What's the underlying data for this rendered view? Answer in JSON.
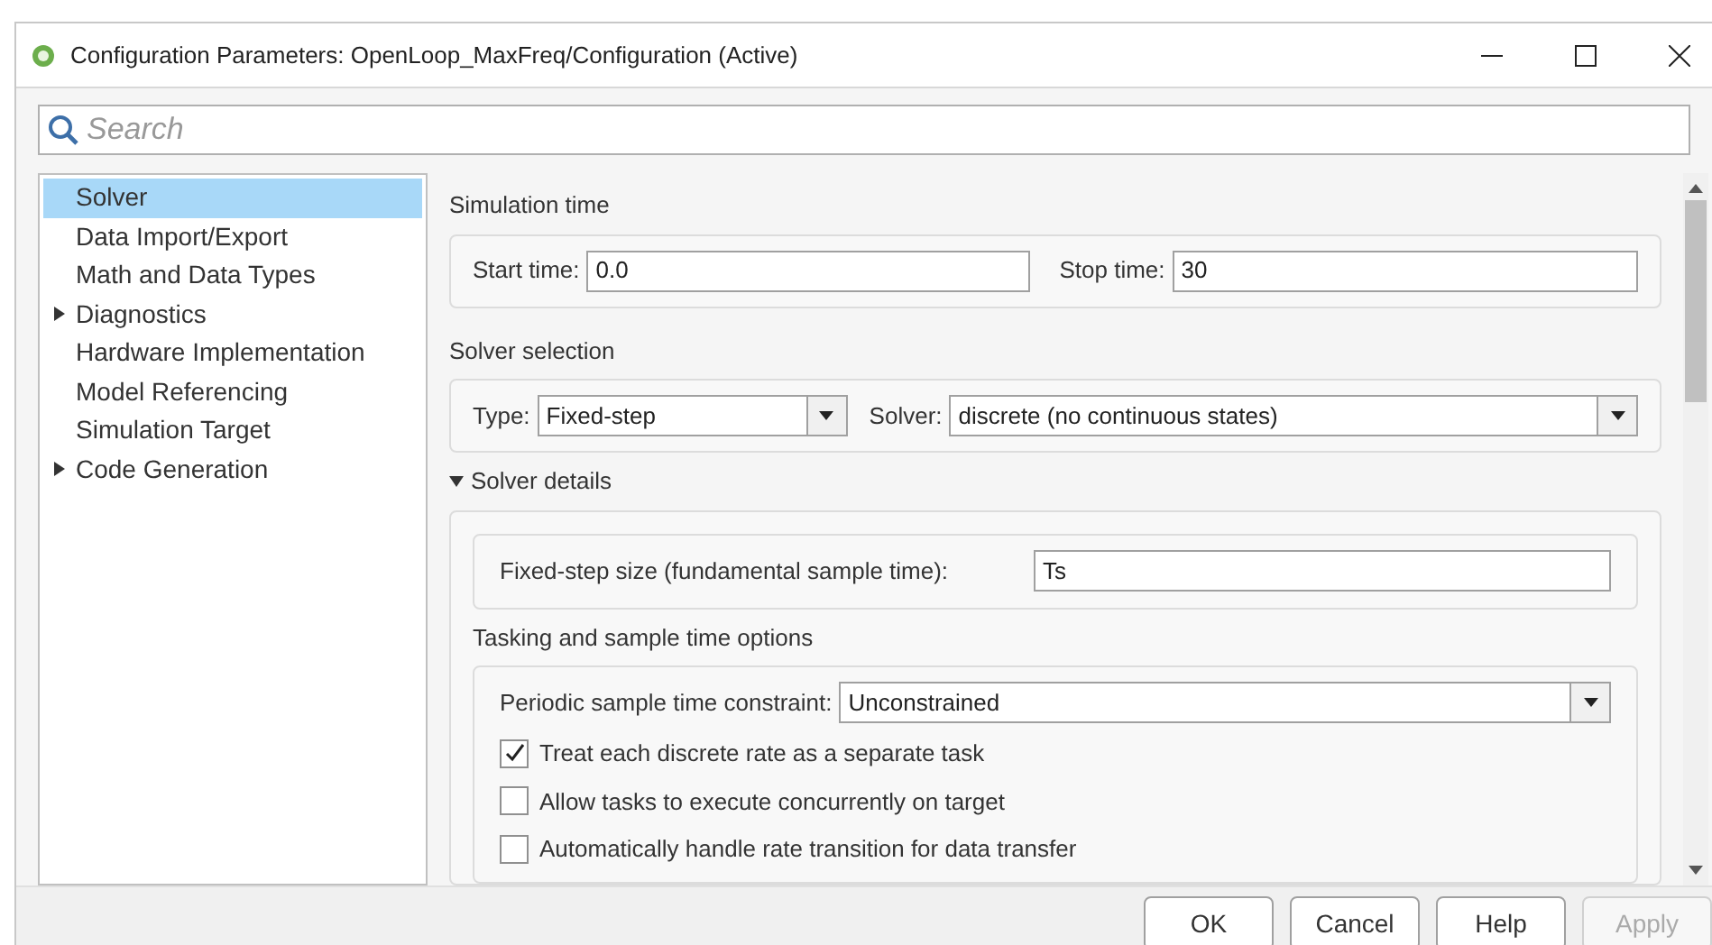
{
  "window": {
    "title": "Configuration Parameters: OpenLoop_MaxFreq/Configuration (Active)"
  },
  "search": {
    "placeholder": "Search"
  },
  "sidebar": {
    "items": [
      {
        "label": "Solver",
        "kind": "leaf",
        "selected": true
      },
      {
        "label": "Data Import/Export",
        "kind": "leaf",
        "selected": false
      },
      {
        "label": "Math and Data Types",
        "kind": "leaf",
        "selected": false
      },
      {
        "label": "Diagnostics",
        "kind": "group",
        "selected": false
      },
      {
        "label": "Hardware Implementation",
        "kind": "leaf",
        "selected": false
      },
      {
        "label": "Model Referencing",
        "kind": "leaf",
        "selected": false
      },
      {
        "label": "Simulation Target",
        "kind": "leaf",
        "selected": false
      },
      {
        "label": "Code Generation",
        "kind": "group",
        "selected": false
      }
    ]
  },
  "simulation_time": {
    "title": "Simulation time",
    "start_label": "Start time:",
    "start_value": "0.0",
    "stop_label": "Stop time:",
    "stop_value": "30"
  },
  "solver_selection": {
    "title": "Solver selection",
    "type_label": "Type:",
    "type_value": "Fixed-step",
    "solver_label": "Solver:",
    "solver_value": "discrete (no continuous states)"
  },
  "solver_details": {
    "title": "Solver details",
    "expanded": true,
    "step_label": "Fixed-step size (fundamental sample time):",
    "step_value": "Ts",
    "tasking": {
      "title": "Tasking and sample time options",
      "constraint_label": "Periodic sample time constraint:",
      "constraint_value": "Unconstrained",
      "options": [
        {
          "label": "Treat each discrete rate as a separate task",
          "checked": true
        },
        {
          "label": "Allow tasks to execute concurrently on target",
          "checked": false
        },
        {
          "label": "Automatically handle rate transition for data transfer",
          "checked": false
        }
      ]
    }
  },
  "buttons": [
    {
      "label": "OK",
      "disabled": false
    },
    {
      "label": "Cancel",
      "disabled": false
    },
    {
      "label": "Help",
      "disabled": false
    },
    {
      "label": "Apply",
      "disabled": true
    }
  ]
}
